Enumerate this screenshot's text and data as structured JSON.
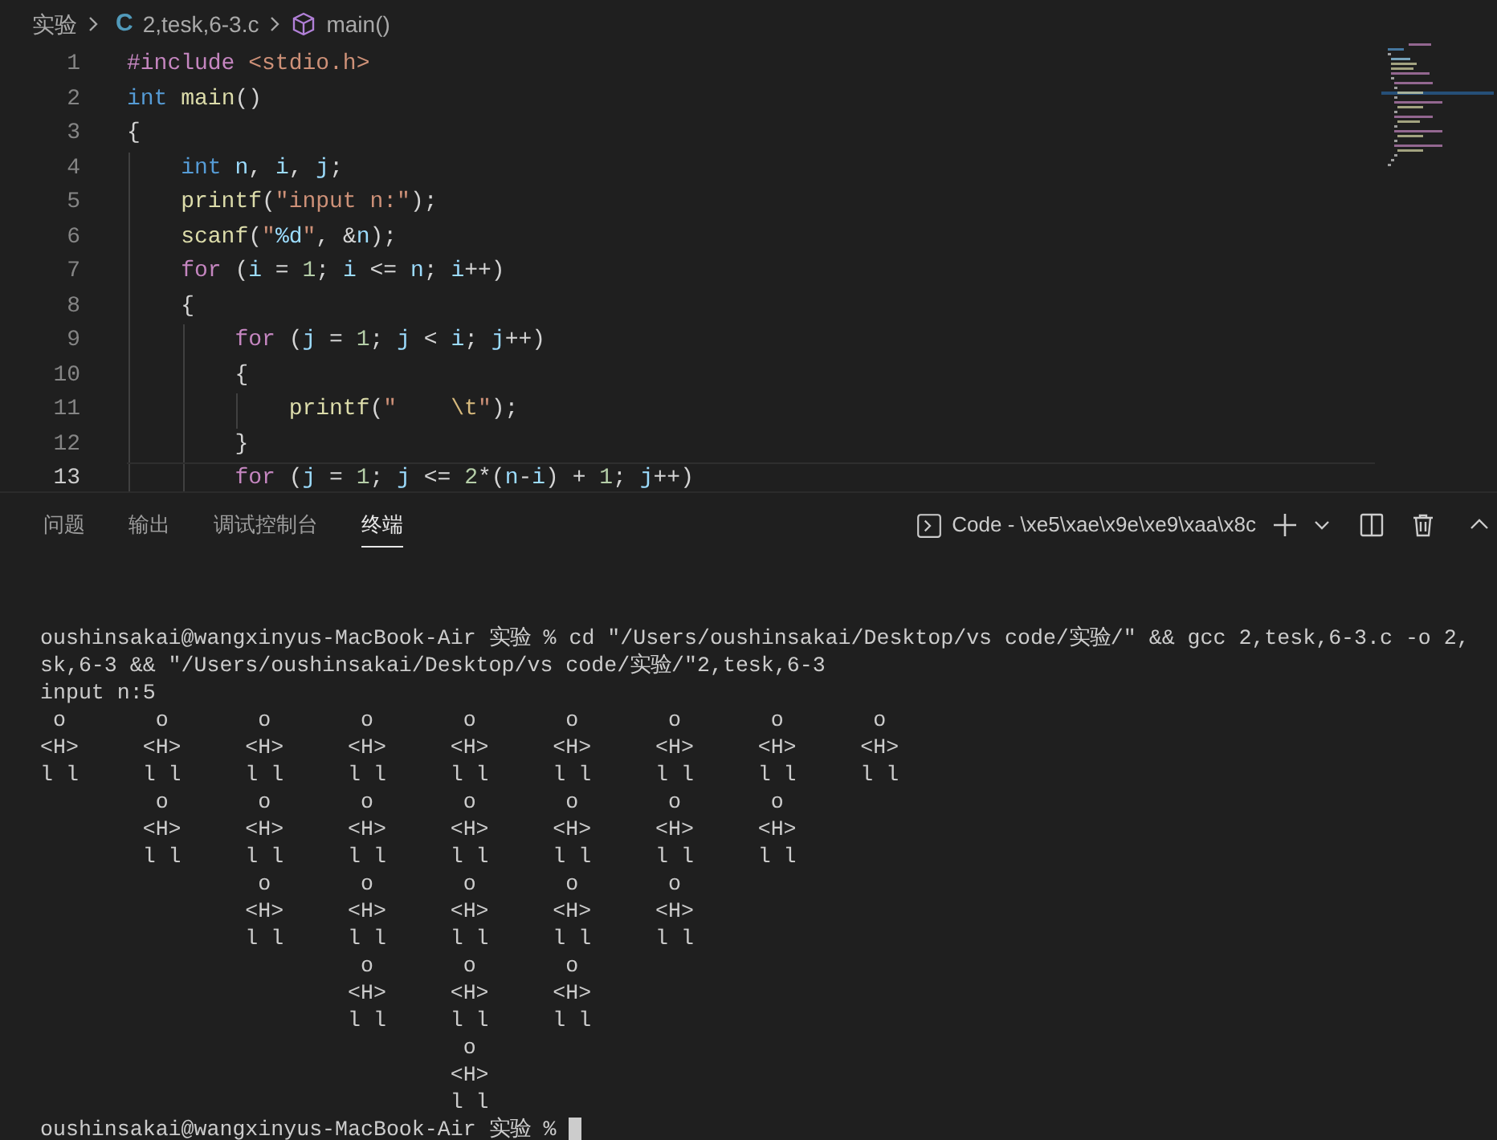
{
  "breadcrumb": {
    "folder": "实验",
    "file_icon": "C",
    "file": "2,tesk,6-3.c",
    "symbol": "main()"
  },
  "editor": {
    "lines": [
      {
        "number": "1",
        "current": false,
        "tokens": [
          {
            "kind": "control",
            "text": "#include "
          },
          {
            "kind": "string",
            "text": "<stdio.h>"
          }
        ]
      },
      {
        "number": "2",
        "current": false,
        "tokens": [
          {
            "kind": "keyword",
            "text": "int "
          },
          {
            "kind": "function",
            "text": "main"
          },
          {
            "kind": "plain",
            "text": "()"
          }
        ]
      },
      {
        "number": "3",
        "current": false,
        "tokens": [
          {
            "kind": "plain",
            "text": "{"
          }
        ]
      },
      {
        "number": "4",
        "current": false,
        "tokens": [
          {
            "kind": "keyword",
            "text": "    int "
          },
          {
            "kind": "variable",
            "text": "n"
          },
          {
            "kind": "plain",
            "text": ", "
          },
          {
            "kind": "variable",
            "text": "i"
          },
          {
            "kind": "plain",
            "text": ", "
          },
          {
            "kind": "variable",
            "text": "j"
          },
          {
            "kind": "plain",
            "text": ";"
          }
        ]
      },
      {
        "number": "5",
        "current": false,
        "tokens": [
          {
            "kind": "function",
            "text": "    printf"
          },
          {
            "kind": "plain",
            "text": "("
          },
          {
            "kind": "string",
            "text": "\"input n:\""
          },
          {
            "kind": "plain",
            "text": ");"
          }
        ]
      },
      {
        "number": "6",
        "current": false,
        "tokens": [
          {
            "kind": "function",
            "text": "    scanf"
          },
          {
            "kind": "plain",
            "text": "("
          },
          {
            "kind": "string",
            "text": "\""
          },
          {
            "kind": "variable",
            "text": "%d"
          },
          {
            "kind": "string",
            "text": "\""
          },
          {
            "kind": "plain",
            "text": ", &"
          },
          {
            "kind": "variable",
            "text": "n"
          },
          {
            "kind": "plain",
            "text": ");"
          }
        ]
      },
      {
        "number": "7",
        "current": false,
        "tokens": [
          {
            "kind": "control",
            "text": "    for"
          },
          {
            "kind": "plain",
            "text": " ("
          },
          {
            "kind": "variable",
            "text": "i"
          },
          {
            "kind": "plain",
            "text": " = "
          },
          {
            "kind": "number",
            "text": "1"
          },
          {
            "kind": "plain",
            "text": "; "
          },
          {
            "kind": "variable",
            "text": "i"
          },
          {
            "kind": "plain",
            "text": " <= "
          },
          {
            "kind": "variable",
            "text": "n"
          },
          {
            "kind": "plain",
            "text": "; "
          },
          {
            "kind": "variable",
            "text": "i"
          },
          {
            "kind": "plain",
            "text": "++)"
          }
        ]
      },
      {
        "number": "8",
        "current": false,
        "tokens": [
          {
            "kind": "plain",
            "text": "    {"
          }
        ]
      },
      {
        "number": "9",
        "current": false,
        "tokens": [
          {
            "kind": "control",
            "text": "        for"
          },
          {
            "kind": "plain",
            "text": " ("
          },
          {
            "kind": "variable",
            "text": "j"
          },
          {
            "kind": "plain",
            "text": " = "
          },
          {
            "kind": "number",
            "text": "1"
          },
          {
            "kind": "plain",
            "text": "; "
          },
          {
            "kind": "variable",
            "text": "j"
          },
          {
            "kind": "plain",
            "text": " < "
          },
          {
            "kind": "variable",
            "text": "i"
          },
          {
            "kind": "plain",
            "text": "; "
          },
          {
            "kind": "variable",
            "text": "j"
          },
          {
            "kind": "plain",
            "text": "++)"
          }
        ]
      },
      {
        "number": "10",
        "current": false,
        "tokens": [
          {
            "kind": "plain",
            "text": "        {"
          }
        ]
      },
      {
        "number": "11",
        "current": false,
        "tokens": [
          {
            "kind": "function",
            "text": "            printf"
          },
          {
            "kind": "plain",
            "text": "("
          },
          {
            "kind": "string",
            "text": "\"    "
          },
          {
            "kind": "escape",
            "text": "\\t"
          },
          {
            "kind": "string",
            "text": "\""
          },
          {
            "kind": "plain",
            "text": ");"
          }
        ]
      },
      {
        "number": "12",
        "current": false,
        "tokens": [
          {
            "kind": "plain",
            "text": "        }"
          }
        ]
      },
      {
        "number": "13",
        "current": true,
        "tokens": [
          {
            "kind": "control",
            "text": "        for"
          },
          {
            "kind": "plain",
            "text": " ("
          },
          {
            "kind": "variable",
            "text": "j"
          },
          {
            "kind": "plain",
            "text": " = "
          },
          {
            "kind": "number",
            "text": "1"
          },
          {
            "kind": "plain",
            "text": "; "
          },
          {
            "kind": "variable",
            "text": "j"
          },
          {
            "kind": "plain",
            "text": " <= "
          },
          {
            "kind": "number",
            "text": "2"
          },
          {
            "kind": "plain",
            "text": "*("
          },
          {
            "kind": "variable",
            "text": "n"
          },
          {
            "kind": "plain",
            "text": "-"
          },
          {
            "kind": "variable",
            "text": "i"
          },
          {
            "kind": "plain",
            "text": ") + "
          },
          {
            "kind": "number",
            "text": "1"
          },
          {
            "kind": "plain",
            "text": "; "
          },
          {
            "kind": "variable",
            "text": "j"
          },
          {
            "kind": "plain",
            "text": "++)"
          }
        ]
      }
    ]
  },
  "panel": {
    "tabs": [
      {
        "label": "问题",
        "selected": false
      },
      {
        "label": "输出",
        "selected": false
      },
      {
        "label": "调试控制台",
        "selected": false
      },
      {
        "label": "终端",
        "selected": true
      }
    ],
    "terminal_name": "Code - \\xe5\\xae\\x9e\\xe9\\xaa\\x8c"
  },
  "terminal": {
    "lines": [
      "oushinsakai@wangxinyus-MacBook-Air 实验 % cd \"/Users/oushinsakai/Desktop/vs code/实验/\" && gcc 2,tesk,6-3.c -o 2,",
      "sk,6-3 && \"/Users/oushinsakai/Desktop/vs code/实验/\"2,tesk,6-3",
      "input n:5",
      " o       o       o       o       o       o       o       o       o",
      "<H>     <H>     <H>     <H>     <H>     <H>     <H>     <H>     <H>",
      "l l     l l     l l     l l     l l     l l     l l     l l     l l",
      "         o       o       o       o       o       o       o",
      "        <H>     <H>     <H>     <H>     <H>     <H>     <H>",
      "        l l     l l     l l     l l     l l     l l     l l",
      "                 o       o       o       o       o",
      "                <H>     <H>     <H>     <H>     <H>",
      "                l l     l l     l l     l l     l l",
      "                         o       o       o",
      "                        <H>     <H>     <H>",
      "                        l l     l l     l l",
      "                                 o",
      "                                <H>",
      "                                l l"
    ],
    "prompt": "oushinsakai@wangxinyus-MacBook-Air 实验 %",
    "cursor": true
  }
}
